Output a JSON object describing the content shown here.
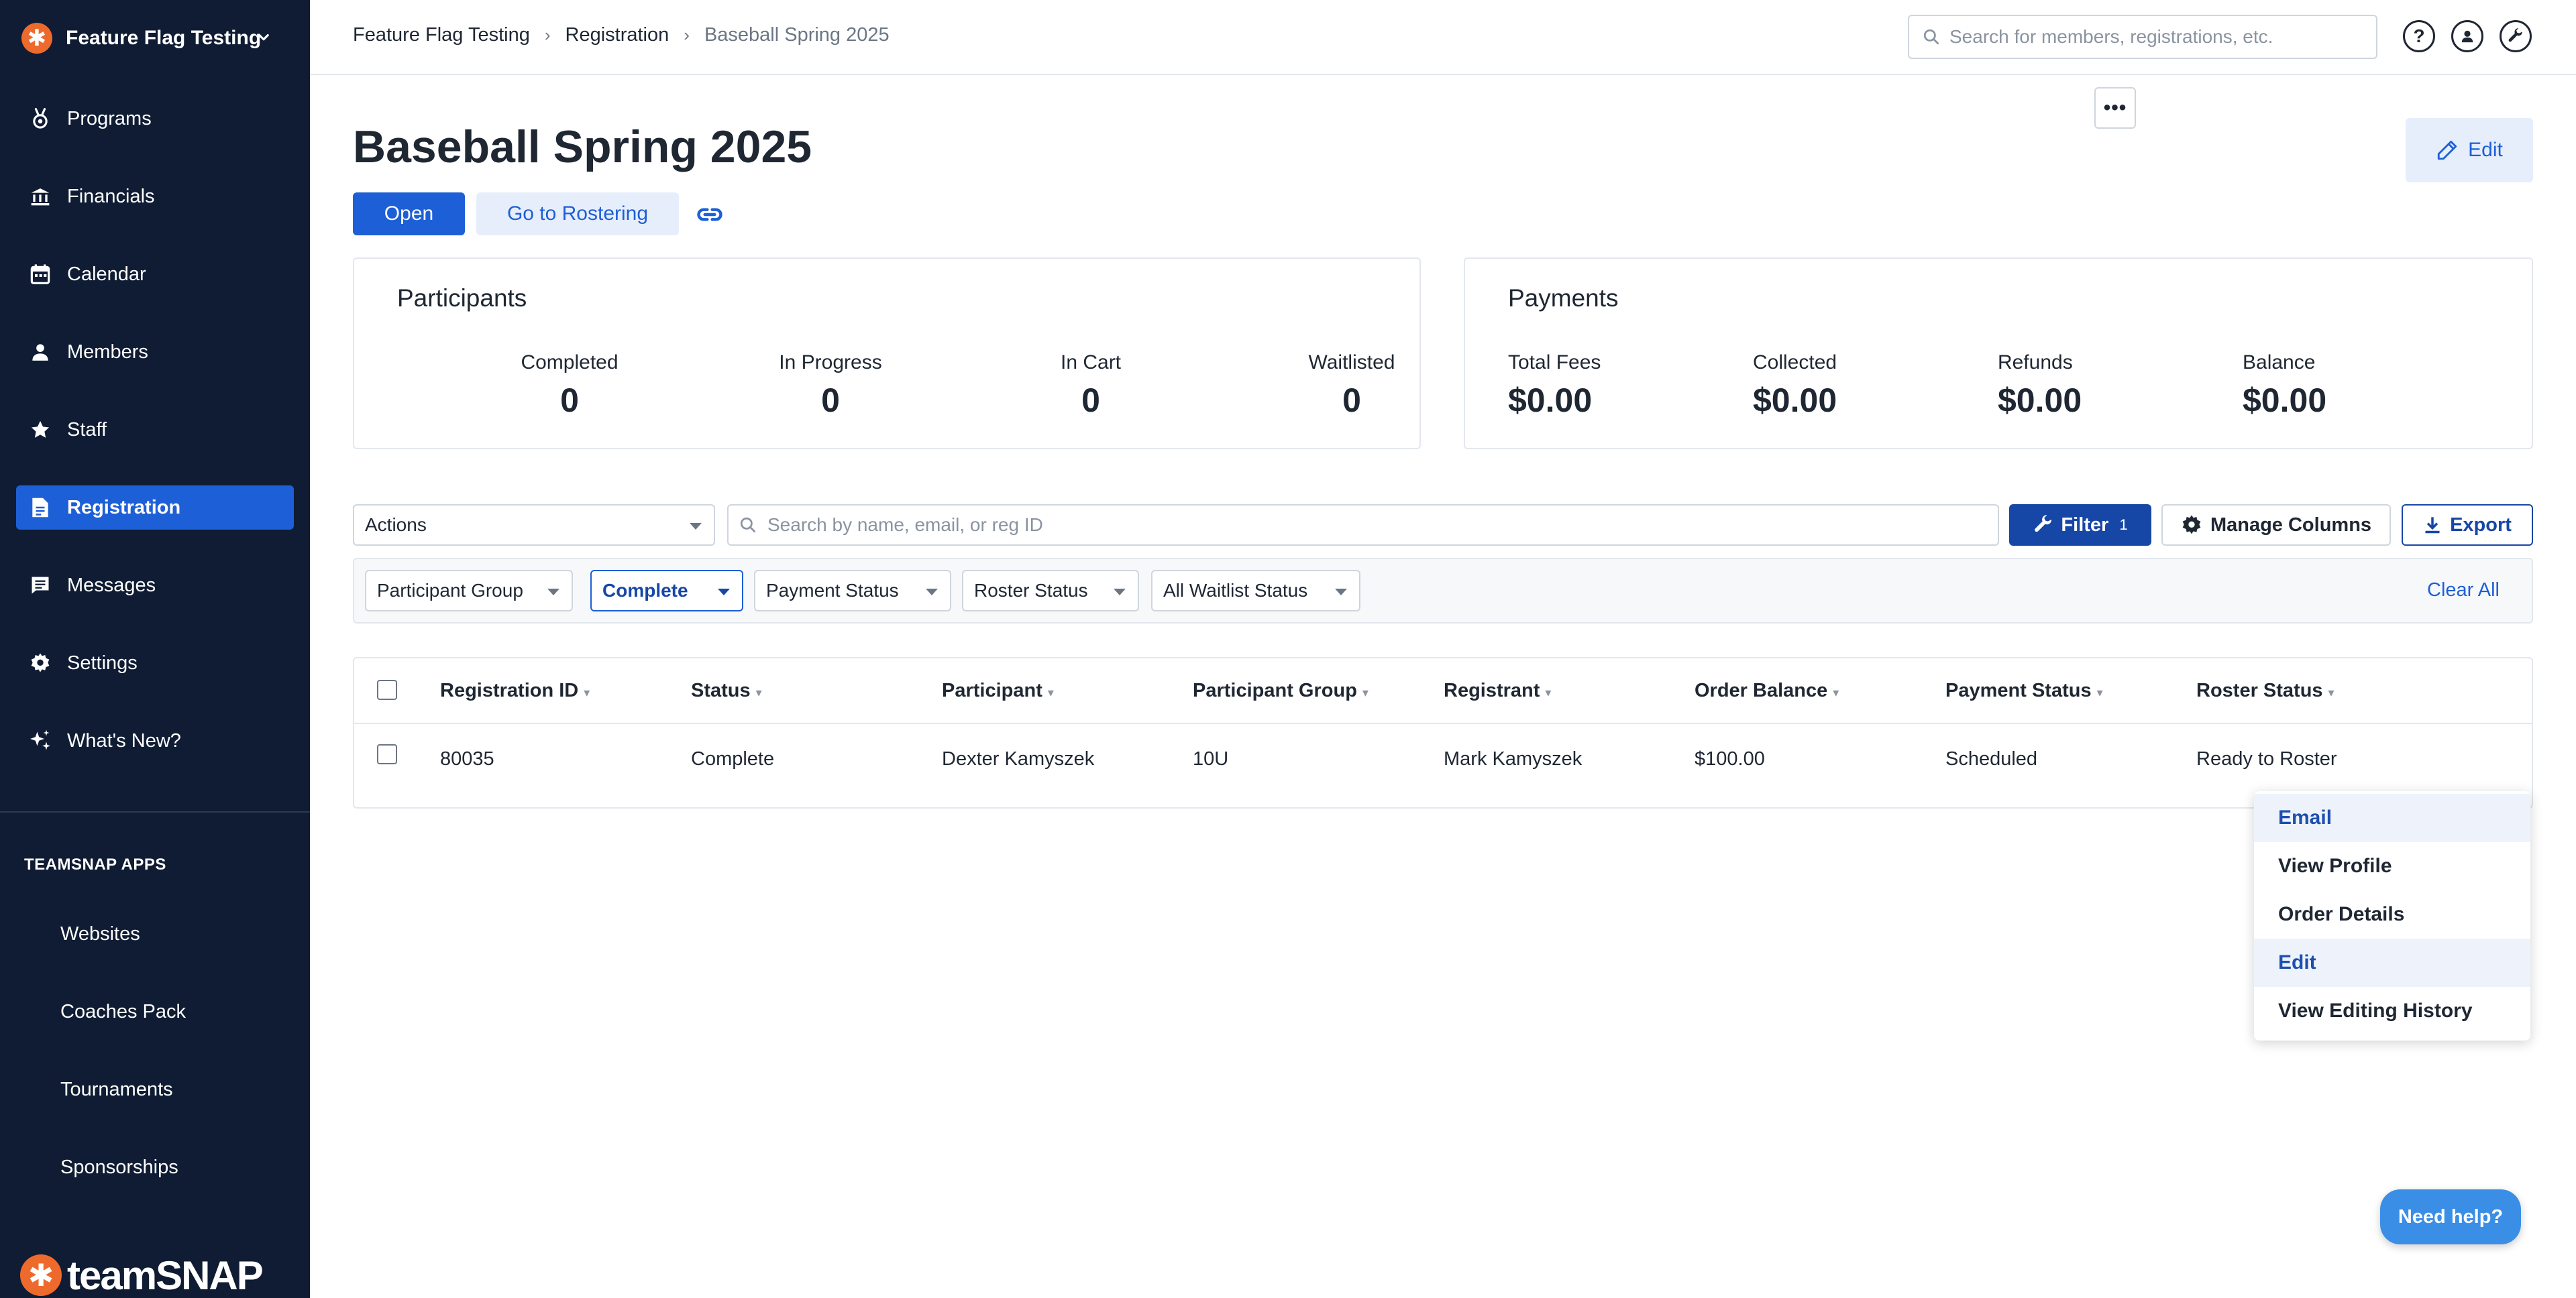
{
  "sidebar": {
    "org_name": "Feature Flag Testing",
    "org_icon": "asterisk-logo-icon",
    "items": [
      {
        "label": "Programs",
        "icon": "medal-icon",
        "active": false
      },
      {
        "label": "Financials",
        "icon": "bank-icon",
        "active": false
      },
      {
        "label": "Calendar",
        "icon": "calendar-icon",
        "active": false
      },
      {
        "label": "Members",
        "icon": "person-icon",
        "active": false
      },
      {
        "label": "Staff",
        "icon": "star-icon",
        "active": false
      },
      {
        "label": "Registration",
        "icon": "document-icon",
        "active": true
      },
      {
        "label": "Messages",
        "icon": "message-icon",
        "active": false
      },
      {
        "label": "Settings",
        "icon": "gear-icon",
        "active": false
      },
      {
        "label": "What's New?",
        "icon": "sparkle-icon",
        "active": false
      }
    ],
    "apps_title": "TEAMSNAP APPS",
    "apps": [
      "Websites",
      "Coaches Pack",
      "Tournaments",
      "Sponsorships"
    ],
    "brand": "teamSNAP"
  },
  "topbar": {
    "breadcrumbs": [
      "Feature Flag Testing",
      "Registration",
      "Baseball Spring 2025"
    ],
    "search_placeholder": "Search for members, registrations, etc."
  },
  "header": {
    "title": "Baseball Spring 2025",
    "status_label": "Open",
    "rostering_label": "Go to Rostering",
    "edit_label": "Edit"
  },
  "participants": {
    "title": "Participants",
    "stats": [
      {
        "label": "Completed",
        "value": "0"
      },
      {
        "label": "In Progress",
        "value": "0"
      },
      {
        "label": "In Cart",
        "value": "0"
      },
      {
        "label": "Waitlisted",
        "value": "0"
      }
    ]
  },
  "payments": {
    "title": "Payments",
    "stats": [
      {
        "label": "Total Fees",
        "value": "$0.00"
      },
      {
        "label": "Collected",
        "value": "$0.00"
      },
      {
        "label": "Refunds",
        "value": "$0.00"
      },
      {
        "label": "Balance",
        "value": "$0.00"
      }
    ]
  },
  "toolbar": {
    "actions_label": "Actions",
    "search_placeholder": "Search by name, email, or reg ID",
    "filter_label": "Filter",
    "filter_count": "1",
    "manage_columns_label": "Manage Columns",
    "export_label": "Export"
  },
  "filters": {
    "items": [
      "Participant Group",
      "Complete",
      "Payment Status",
      "Roster Status",
      "All Waitlist Status"
    ],
    "clear_all": "Clear All"
  },
  "table": {
    "columns": [
      "Registration ID",
      "Status",
      "Participant",
      "Participant Group",
      "Registrant",
      "Order Balance",
      "Payment Status",
      "Roster Status"
    ],
    "rows": [
      [
        "80035",
        "Complete",
        "Dexter Kamyszek",
        "10U",
        "Mark Kamyszek",
        "$100.00",
        "Scheduled",
        "Ready to Roster"
      ]
    ],
    "row_menu_label": "•••"
  },
  "row_menu": {
    "items": [
      "Email",
      "View Profile",
      "Order Details",
      "Edit",
      "View Editing History"
    ]
  },
  "help_label": "Need help?",
  "colors": {
    "sidebar_bg": "#0f1c33",
    "accent": "#1d5fd6",
    "accent_dark": "#1747a6",
    "brand_orange": "#ee6a2c"
  }
}
